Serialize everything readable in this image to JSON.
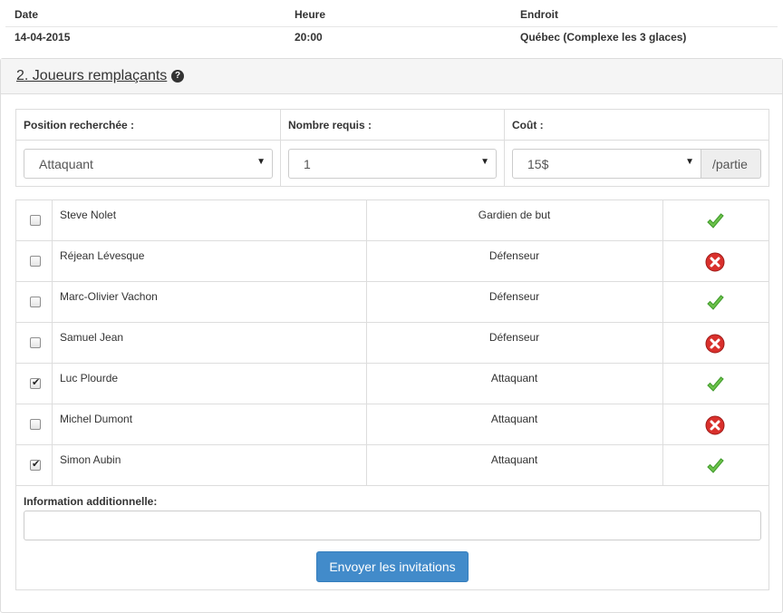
{
  "event": {
    "headers": {
      "date": "Date",
      "time": "Heure",
      "place": "Endroit"
    },
    "values": {
      "date": "14-04-2015",
      "time": "20:00",
      "place": "Québec (Complexe les 3 glaces)"
    }
  },
  "section": {
    "title": "2. Joueurs remplaçants",
    "help_icon": "question-circle-icon"
  },
  "criteria": {
    "position_label": "Position recherchée :",
    "position_value": "Attaquant",
    "count_label": "Nombre requis :",
    "count_value": "1",
    "cost_label": "Coût :",
    "cost_value": "15$",
    "cost_suffix": "/partie"
  },
  "players": [
    {
      "name": "Steve Nolet",
      "position": "Gardien de but",
      "checked": false,
      "available": true
    },
    {
      "name": "Réjean Lévesque",
      "position": "Défenseur",
      "checked": false,
      "available": false
    },
    {
      "name": "Marc-Olivier Vachon",
      "position": "Défenseur",
      "checked": false,
      "available": true
    },
    {
      "name": "Samuel Jean",
      "position": "Défenseur",
      "checked": false,
      "available": false
    },
    {
      "name": "Luc Plourde",
      "position": "Attaquant",
      "checked": true,
      "available": true
    },
    {
      "name": "Michel Dumont",
      "position": "Attaquant",
      "checked": false,
      "available": false
    },
    {
      "name": "Simon Aubin",
      "position": "Attaquant",
      "checked": true,
      "available": true
    }
  ],
  "additional": {
    "label": "Information additionnelle:",
    "value": ""
  },
  "send_button": "Envoyer les invitations",
  "colors": {
    "primary": "#428bca",
    "available": "#5cb85c",
    "unavailable": "#d9302c"
  }
}
